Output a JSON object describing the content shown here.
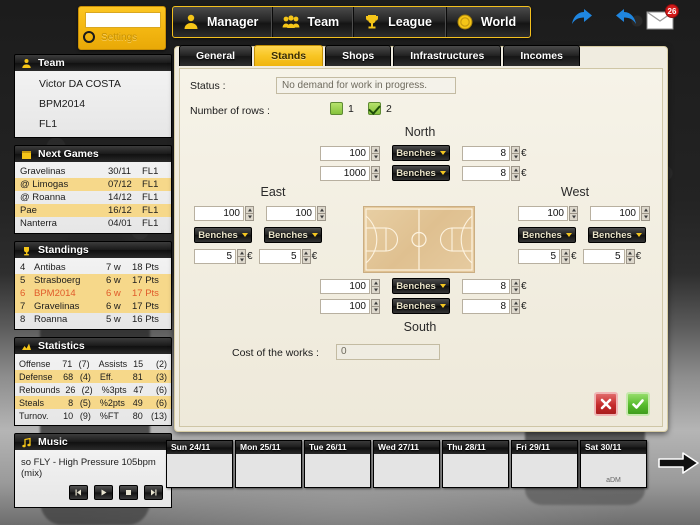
{
  "settings": {
    "label": "Settings",
    "input_value": ""
  },
  "topnav": {
    "items": [
      {
        "label": "Manager",
        "icon": "person-icon"
      },
      {
        "label": "Team",
        "icon": "group-icon"
      },
      {
        "label": "League",
        "icon": "trophy-icon"
      },
      {
        "label": "World",
        "icon": "coin-icon"
      }
    ],
    "back_icon": "back-arrow-icon",
    "forward_icon": "forward-arrow-icon",
    "mail_icon": "mail-icon",
    "mail_badge": "26"
  },
  "sidebar": {
    "team": {
      "title": "Team",
      "icon": "person-icon",
      "lines": [
        "Victor DA COSTA",
        "BPM2014",
        "FL1"
      ]
    },
    "next_games": {
      "title": "Next Games",
      "icon": "calendar-icon",
      "rows": [
        {
          "name": "Gravelinas",
          "date": "30/11",
          "league": "FL1"
        },
        {
          "name": "@ Limogas",
          "date": "07/12",
          "league": "FL1"
        },
        {
          "name": "@ Roanna",
          "date": "14/12",
          "league": "FL1"
        },
        {
          "name": "Pae",
          "date": "16/12",
          "league": "FL1"
        },
        {
          "name": "Nanterra",
          "date": "04/01",
          "league": "FL1"
        }
      ]
    },
    "standings": {
      "title": "Standings",
      "icon": "trophy-icon",
      "rows": [
        {
          "rank": "4",
          "team": "Antibas",
          "wins": "7 w",
          "pts": "18 Pts"
        },
        {
          "rank": "5",
          "team": "Strasboerg",
          "wins": "6 w",
          "pts": "17 Pts"
        },
        {
          "rank": "6",
          "team": "BPM2014",
          "wins": "6 w",
          "pts": "17 Pts"
        },
        {
          "rank": "7",
          "team": "Gravelinas",
          "wins": "6 w",
          "pts": "17 Pts"
        },
        {
          "rank": "8",
          "team": "Roanna",
          "wins": "5 w",
          "pts": "16 Pts"
        }
      ]
    },
    "statistics": {
      "title": "Statistics",
      "icon": "chart-icon",
      "rows": [
        {
          "l1": "Offense",
          "v1": "71",
          "p1": "(7)",
          "l2": "Assists",
          "v2": "15",
          "p2": "(2)"
        },
        {
          "l1": "Defense",
          "v1": "68",
          "p1": "(4)",
          "l2": "Eff.",
          "v2": "81",
          "p2": "(3)"
        },
        {
          "l1": "Rebounds",
          "v1": "26",
          "p1": "(2)",
          "l2": "%3pts",
          "v2": "47",
          "p2": "(6)"
        },
        {
          "l1": "Steals",
          "v1": "8",
          "p1": "(5)",
          "l2": "%2pts",
          "v2": "49",
          "p2": "(6)"
        },
        {
          "l1": "Turnov.",
          "v1": "10",
          "p1": "(9)",
          "l2": "%FT",
          "v2": "80",
          "p2": "(13)"
        }
      ]
    },
    "music": {
      "title": "Music",
      "icon": "music-note-icon",
      "track": "so FLY - High Pressure 105bpm (mix)",
      "buttons": [
        "prev-button",
        "play-button",
        "stop-button",
        "next-button"
      ]
    }
  },
  "main": {
    "tabs": [
      {
        "label": "General",
        "active": false
      },
      {
        "label": "Stands",
        "active": true
      },
      {
        "label": "Shops",
        "active": false
      },
      {
        "label": "Infrastructures",
        "active": false
      },
      {
        "label": "Incomes",
        "active": false
      }
    ],
    "status_label": "Status :",
    "status_value": "No demand for work in progress.",
    "rows_label": "Number of rows :",
    "row_options": [
      {
        "label": "1",
        "checked": false
      },
      {
        "label": "2",
        "checked": true
      }
    ],
    "dropdown_label": "Benches",
    "currency": "€",
    "stands": {
      "north": {
        "title": "North",
        "rows": [
          {
            "capacity": "100",
            "type": "Benches",
            "price": "8"
          },
          {
            "capacity": "1000",
            "type": "Benches",
            "price": "8"
          }
        ]
      },
      "south": {
        "title": "South",
        "rows": [
          {
            "capacity": "100",
            "type": "Benches",
            "price": "8"
          },
          {
            "capacity": "100",
            "type": "Benches",
            "price": "8"
          }
        ]
      },
      "east": {
        "title": "East",
        "columns": [
          {
            "capacity": "100",
            "type": "Benches",
            "price": "5"
          },
          {
            "capacity": "100",
            "type": "Benches",
            "price": "5"
          }
        ]
      },
      "west": {
        "title": "West",
        "columns": [
          {
            "capacity": "100",
            "type": "Benches",
            "price": "5"
          },
          {
            "capacity": "100",
            "type": "Benches",
            "price": "5"
          }
        ]
      }
    },
    "cost_label": "Cost of the works :",
    "cost_value": "0",
    "cancel_icon": "cross-icon",
    "confirm_icon": "check-icon"
  },
  "calendar": {
    "days": [
      {
        "label": "Sun 24/11",
        "note": ""
      },
      {
        "label": "Mon 25/11",
        "note": ""
      },
      {
        "label": "Tue 26/11",
        "note": ""
      },
      {
        "label": "Wed 27/11",
        "note": ""
      },
      {
        "label": "Thu 28/11",
        "note": ""
      },
      {
        "label": "Fri 29/11",
        "note": ""
      },
      {
        "label": "Sat 30/11",
        "note": "aDM"
      }
    ],
    "next_icon": "next-arrow-icon"
  },
  "colors": {
    "accent": "#f5c518",
    "panel_dark": "#161616",
    "highlight_row": "#f6d88a",
    "own_team": "#e05b2a"
  }
}
